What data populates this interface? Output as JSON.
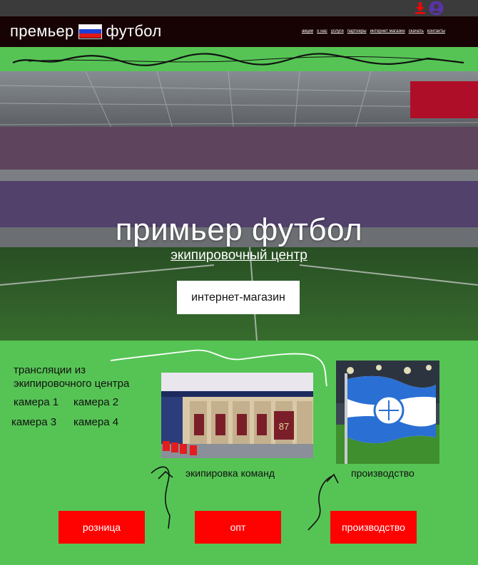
{
  "header": {
    "brand_left": "премьер",
    "brand_right": "футбол",
    "nav": [
      "акции",
      "о нас",
      "услуги",
      "партнеры",
      "интернет магазин",
      "скачать",
      "контакты"
    ]
  },
  "hero": {
    "title": "примьер футбол",
    "subtitle": "экипировочный центр",
    "button": "интернет-магазин"
  },
  "streams": {
    "title_line1": "трансляции из",
    "title_line2": "экипировочного центра",
    "cameras": [
      "камера 1",
      "камера 2",
      "камера 3",
      "камера 4"
    ]
  },
  "cards": {
    "locker_caption": "экипировка команд",
    "flag_caption": "производство",
    "jersey_number": "87"
  },
  "buttons": {
    "retail": "розница",
    "wholesale": "опт",
    "production": "производство"
  },
  "colors": {
    "background_green": "#56c455",
    "header_dark": "#170303",
    "accent_red": "#fe0202",
    "user_icon_purple": "#5a32a8"
  },
  "icons": {
    "download": "download-icon",
    "user": "user-icon"
  }
}
